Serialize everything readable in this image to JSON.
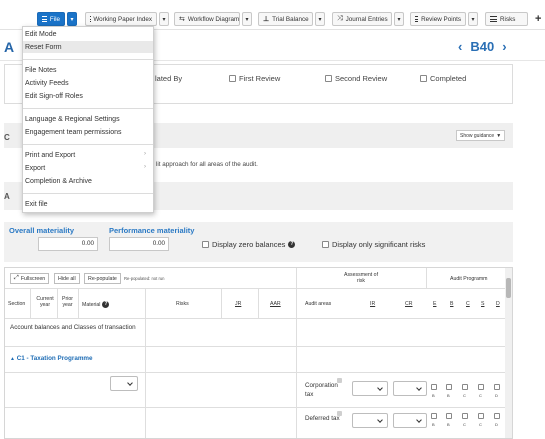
{
  "toolbar": {
    "file_label": "File",
    "working_paper_index": "Working Paper Index",
    "workflow_diagram": "Workflow Diagram",
    "trial_balance": "Trial Balance",
    "journal_entries": "Journal Entries",
    "review_points": "Review Points",
    "risks": "Risks",
    "dropdown_glyph": "▾",
    "add_glyph": "+"
  },
  "file_menu": {
    "items": [
      {
        "label": "Edit Mode"
      },
      {
        "label": "Reset Form"
      },
      {
        "label": "File Notes"
      },
      {
        "label": "Activity Feeds"
      },
      {
        "label": "Edit Sign-off Roles"
      },
      {
        "label": "Language & Regional Settings"
      },
      {
        "label": "Engagement team permissions"
      },
      {
        "label": "Print and Export"
      },
      {
        "label": "Export"
      },
      {
        "label": "Completion & Archive"
      },
      {
        "label": "Exit file"
      }
    ],
    "highlighted": "Reset Form",
    "submenu_glyph": "›"
  },
  "header": {
    "title_fragment": "A",
    "prev_glyph": "‹",
    "code": "B40",
    "next_glyph": "›"
  },
  "signoff": {
    "first_col_fragment": "lated By",
    "first_review": "First Review",
    "second_review": "Second Review",
    "completed": "Completed"
  },
  "guidance": {
    "show_guidance": "Show guidance",
    "section_fragment": "C",
    "approach_text": "lit approach for all areas of the audit.",
    "band_fragment": "A"
  },
  "materiality": {
    "overall_label": "Overall materiality",
    "overall_value": "0.00",
    "performance_label": "Performance materiality",
    "performance_value": "0.00",
    "display_zero_balances": "Display zero balances",
    "display_significant_risks": "Display only significant risks"
  },
  "grid": {
    "fullscreen": "Fullscreen",
    "hide_all": "Hide all",
    "repopulate": "Re-populate",
    "repopulate_note": "Re-populated: not run",
    "assessment_of_risk": "Assessment of risk",
    "audit_programme": "Audit Programm",
    "columns": {
      "section": "Section",
      "current_year": "Current year",
      "prior_year": "Prior year",
      "material": "Material",
      "risks": "Risks",
      "jr": "JR",
      "aar": "AAR",
      "audit_areas": "Audit areas",
      "ir": "IR",
      "cr": "CR",
      "e": "E",
      "b": "B",
      "c": "C",
      "s": "S",
      "d": "D"
    },
    "group_label": "Account balances and Classes of transaction",
    "programme_label": "C1 - Taxation Programme",
    "rows": [
      {
        "audit_area": "Corporation tax"
      },
      {
        "audit_area": "Deferred tax"
      }
    ],
    "cb_letters": [
      "B",
      "B",
      "C",
      "C",
      "D"
    ]
  }
}
